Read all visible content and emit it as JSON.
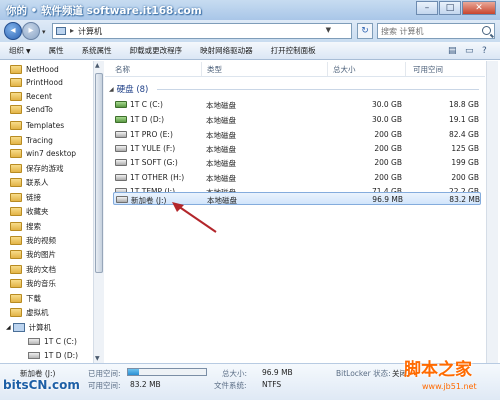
{
  "watermarks": {
    "top": "你的 • 软件频道 software.it168.com",
    "bottom_left": "bitsCN.com",
    "bottom_right_big": "脚本之家",
    "bottom_right_small": "www.jb51.net"
  },
  "address_bar": {
    "separator": "▸",
    "path": "计算机",
    "dropdown": "▼",
    "refresh": "↻",
    "search_placeholder": "搜索 计算机"
  },
  "command_bar": {
    "organize": "组织",
    "items": [
      "属性",
      "系统属性",
      "卸载或更改程序",
      "映射网络驱动器",
      "打开控制面板"
    ]
  },
  "nav_pane": {
    "folders": [
      "NetHood",
      "PrintHood",
      "Recent",
      "SendTo",
      "Templates",
      "Tracing",
      "win7 desktop",
      "保存的游戏",
      "联系人",
      "链接",
      "收藏夹",
      "搜索",
      "我的视频",
      "我的图片",
      "我的文档",
      "我的音乐",
      "下载",
      "虚拟机"
    ],
    "computer": "计算机",
    "drives": [
      "1T C (C:)",
      "1T D (D:)"
    ]
  },
  "columns": {
    "name": "名称",
    "type": "类型",
    "total": "总大小",
    "free": "可用空间"
  },
  "group": {
    "title": "硬盘 (8)"
  },
  "drives": [
    {
      "name": "1T C (C:)",
      "type": "本地磁盘",
      "total": "30.0 GB",
      "free": "18.8 GB",
      "icon": "windows-drive-icon"
    },
    {
      "name": "1T D (D:)",
      "type": "本地磁盘",
      "total": "30.0 GB",
      "free": "19.1 GB",
      "icon": "drive-icon"
    },
    {
      "name": "1T PRO (E:)",
      "type": "本地磁盘",
      "total": "200 GB",
      "free": "82.4 GB",
      "icon": "drive-icon"
    },
    {
      "name": "1T YULE (F:)",
      "type": "本地磁盘",
      "total": "200 GB",
      "free": "125 GB",
      "icon": "drive-icon"
    },
    {
      "name": "1T SOFT (G:)",
      "type": "本地磁盘",
      "total": "200 GB",
      "free": "199 GB",
      "icon": "drive-icon"
    },
    {
      "name": "1T OTHER (H:)",
      "type": "本地磁盘",
      "total": "200 GB",
      "free": "200 GB",
      "icon": "drive-icon"
    },
    {
      "name": "1T TEMP (I:)",
      "type": "本地磁盘",
      "total": "71.4 GB",
      "free": "22.2 GB",
      "icon": "drive-icon"
    },
    {
      "name": "新加卷 (J:)",
      "type": "本地磁盘",
      "total": "96.9 MB",
      "free": "83.2 MB",
      "icon": "drive-icon",
      "selected": true
    }
  ],
  "details": {
    "name": "新加卷 (J:)",
    "used_label": "已用空间:",
    "used_fraction": 0.14,
    "free_label": "可用空间:",
    "free_value": "83.2 MB",
    "total_label": "总大小:",
    "total_value": "96.9 MB",
    "fs_label": "文件系统:",
    "fs_value": "NTFS",
    "bitlocker_label": "BitLocker 状态:",
    "bitlocker_value": "关闭"
  },
  "colors": {
    "accent": "#1e3f87",
    "selection": "#d2e5fb",
    "annotation_arrow": "#b3262b"
  }
}
